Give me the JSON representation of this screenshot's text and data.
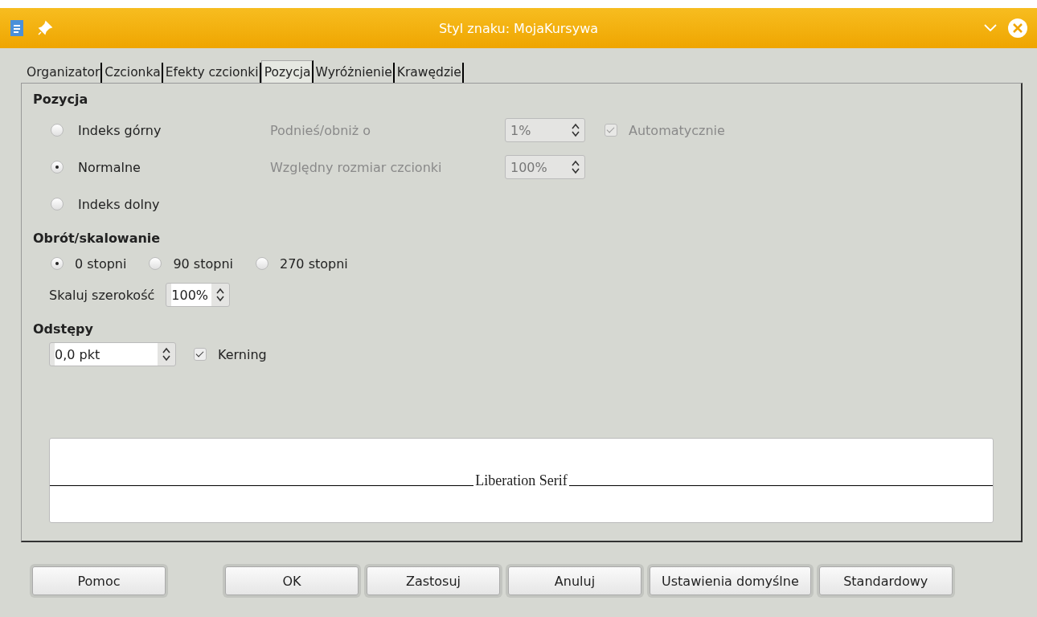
{
  "window": {
    "title": "Styl znaku: MojaKursywa"
  },
  "tabs": [
    {
      "label": "Organizator",
      "selected": false
    },
    {
      "label": "Czcionka",
      "selected": false
    },
    {
      "label": "Efekty czcionki",
      "selected": false
    },
    {
      "label": "Pozycja",
      "selected": true
    },
    {
      "label": "Wyróżnienie",
      "selected": false
    },
    {
      "label": "Krawędzie",
      "selected": false
    }
  ],
  "position": {
    "heading": "Pozycja",
    "options": [
      {
        "label": "Indeks górny",
        "selected": false
      },
      {
        "label": "Normalne",
        "selected": true
      },
      {
        "label": "Indeks dolny",
        "selected": false
      }
    ],
    "raise_label": "Podnieś/obniż o",
    "raise_value": "1%",
    "auto_label": "Automatycznie",
    "auto_checked": true,
    "disabled": true,
    "relsize_label": "Względny rozmiar czcionki",
    "relsize_value": "100%"
  },
  "rotation": {
    "heading": "Obrót/skalowanie",
    "options": [
      {
        "label": "0 stopni",
        "selected": true
      },
      {
        "label": "90 stopni",
        "selected": false
      },
      {
        "label": "270 stopni",
        "selected": false
      }
    ],
    "scale_label": "Skaluj szerokość",
    "scale_value": "100%"
  },
  "spacing": {
    "heading": "Odstępy",
    "value": "0,0 pkt",
    "kerning_label": "Kerning",
    "kerning_checked": true
  },
  "preview": {
    "text": "Liberation Serif"
  },
  "buttons": [
    "Pomoc",
    "OK",
    "Zastosuj",
    "Anuluj",
    "Ustawienia domyślne",
    "Standardowy"
  ]
}
